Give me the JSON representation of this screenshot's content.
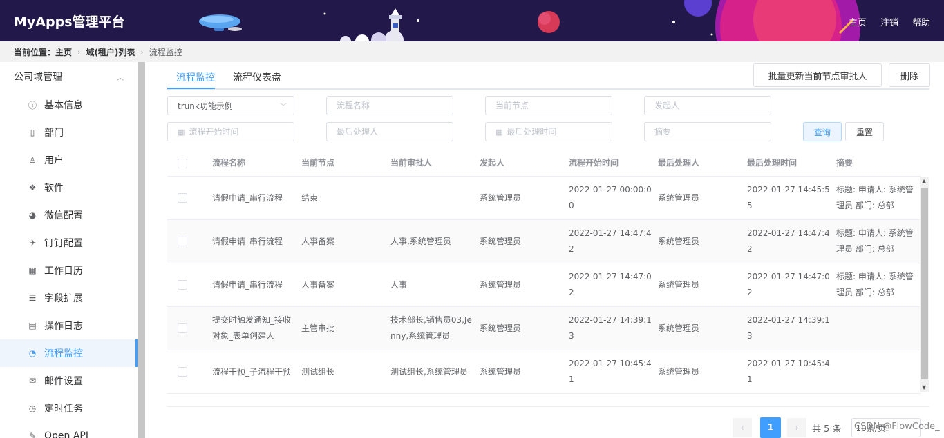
{
  "header": {
    "logo": "MyApps管理平台",
    "nav": [
      "主页",
      "注销",
      "帮助"
    ]
  },
  "breadcrumb": {
    "prefix": "当前位置：",
    "items": [
      "主页",
      "域(租户)列表",
      "流程监控"
    ]
  },
  "sidebar": {
    "group": "公司域管理",
    "items": [
      {
        "label": "基本信息",
        "icon": "info-icon"
      },
      {
        "label": "部门",
        "icon": "building-icon"
      },
      {
        "label": "用户",
        "icon": "user-icon"
      },
      {
        "label": "软件",
        "icon": "cubes-icon"
      },
      {
        "label": "微信配置",
        "icon": "wechat-icon"
      },
      {
        "label": "钉钉配置",
        "icon": "plane-icon"
      },
      {
        "label": "工作日历",
        "icon": "calendar-icon"
      },
      {
        "label": "字段扩展",
        "icon": "sliders-icon"
      },
      {
        "label": "操作日志",
        "icon": "log-icon"
      },
      {
        "label": "流程监控",
        "icon": "dashboard-icon",
        "active": true
      },
      {
        "label": "邮件设置",
        "icon": "mail-icon"
      },
      {
        "label": "定时任务",
        "icon": "clock-icon"
      },
      {
        "label": "Open API",
        "icon": "api-icon"
      }
    ]
  },
  "tabs": [
    "流程监控",
    "流程仪表盘"
  ],
  "actions": {
    "batch_update": "批量更新当前节点审批人",
    "delete": "删除"
  },
  "filters": {
    "app_select": "trunk功能示例",
    "flow_name": "流程名称",
    "current_node": "当前节点",
    "initiator": "发起人",
    "start_time": "流程开始时间",
    "last_handler": "最后处理人",
    "last_time": "最后处理时间",
    "summary": "摘要",
    "query": "查询",
    "reset": "重置"
  },
  "table": {
    "headers": [
      "流程名称",
      "当前节点",
      "当前审批人",
      "发起人",
      "流程开始时间",
      "最后处理人",
      "最后处理时间",
      "摘要"
    ],
    "rows": [
      [
        "请假申请_串行流程",
        "结束",
        "",
        "系统管理员",
        "2022-01-27 00:00:00",
        "系统管理员",
        "2022-01-27 14:45:55",
        "标题: 申请人: 系统管理员 部门: 总部"
      ],
      [
        "请假申请_串行流程",
        "人事备案",
        "人事,系统管理员",
        "系统管理员",
        "2022-01-27 14:47:42",
        "系统管理员",
        "2022-01-27 14:47:42",
        "标题: 申请人: 系统管理员 部门: 总部"
      ],
      [
        "请假申请_串行流程",
        "人事备案",
        "人事",
        "系统管理员",
        "2022-01-27 14:47:02",
        "系统管理员",
        "2022-01-27 14:47:02",
        "标题: 申请人: 系统管理员 部门: 总部"
      ],
      [
        "提交时触发通知_接收对象_表单创建人",
        "主管审批",
        "技术部长,销售员03,Jenny,系统管理员",
        "系统管理员",
        "2022-01-27 14:39:13",
        "系统管理员",
        "2022-01-27 14:39:13",
        ""
      ],
      [
        "流程干预_子流程干预",
        "测试组长",
        "测试组长,系统管理员",
        "系统管理员",
        "2022-01-27 10:45:41",
        "系统管理员",
        "2022-01-27 10:45:41",
        ""
      ]
    ]
  },
  "pagination": {
    "current": "1",
    "total": "共 5 条",
    "page_size": "10条/页"
  },
  "watermark": "CSDN @FlowCode_",
  "colors": {
    "accent": "#409eff",
    "header_bg": "#22184a"
  }
}
